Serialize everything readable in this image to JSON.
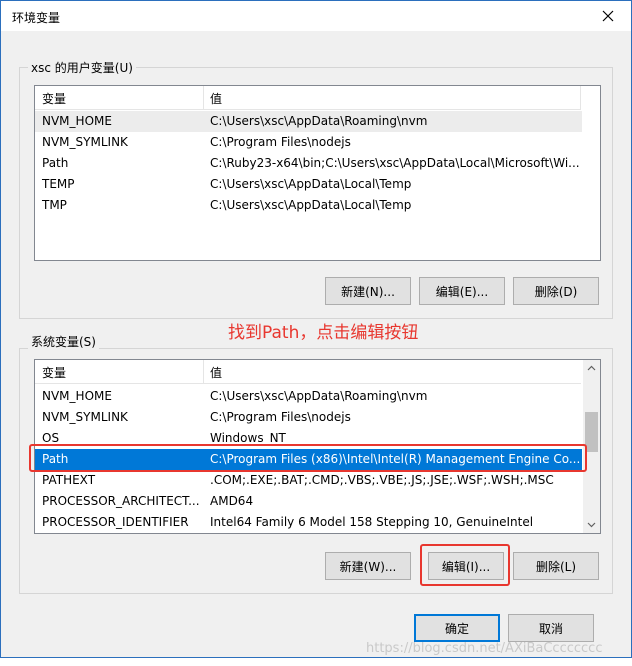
{
  "window": {
    "title": "环境变量"
  },
  "user_vars": {
    "group_label": "xsc 的用户变量(U)",
    "columns": [
      "变量",
      "值"
    ],
    "rows": [
      {
        "name": "NVM_HOME",
        "value": "C:\\Users\\xsc\\AppData\\Roaming\\nvm"
      },
      {
        "name": "NVM_SYMLINK",
        "value": "C:\\Program Files\\nodejs"
      },
      {
        "name": "Path",
        "value": "C:\\Ruby23-x64\\bin;C:\\Users\\xsc\\AppData\\Local\\Microsoft\\Wi..."
      },
      {
        "name": "TEMP",
        "value": "C:\\Users\\xsc\\AppData\\Local\\Temp"
      },
      {
        "name": "TMP",
        "value": "C:\\Users\\xsc\\AppData\\Local\\Temp"
      }
    ],
    "buttons": {
      "new": "新建(N)...",
      "edit": "编辑(E)...",
      "delete": "删除(D)"
    }
  },
  "annotation": "找到Path，点击编辑按钮",
  "system_vars": {
    "group_label": "系统变量(S)",
    "columns": [
      "变量",
      "值"
    ],
    "rows": [
      {
        "name": "NVM_HOME",
        "value": "C:\\Users\\xsc\\AppData\\Roaming\\nvm"
      },
      {
        "name": "NVM_SYMLINK",
        "value": "C:\\Program Files\\nodejs"
      },
      {
        "name": "OS",
        "value": "Windows_NT"
      },
      {
        "name": "Path",
        "value": "C:\\Program Files (x86)\\Intel\\Intel(R) Management Engine Co..."
      },
      {
        "name": "PATHEXT",
        "value": ".COM;.EXE;.BAT;.CMD;.VBS;.VBE;.JS;.JSE;.WSF;.WSH;.MSC"
      },
      {
        "name": "PROCESSOR_ARCHITECT...",
        "value": "AMD64"
      },
      {
        "name": "PROCESSOR_IDENTIFIER",
        "value": "Intel64 Family 6 Model 158 Stepping 10, GenuineIntel"
      }
    ],
    "selected_row": "Path",
    "buttons": {
      "new": "新建(W)...",
      "edit": "编辑(I)...",
      "delete": "删除(L)"
    }
  },
  "dialog_buttons": {
    "ok": "确定",
    "cancel": "取消"
  },
  "watermark": "https://blog.csdn.net/AXiBaCccccccc",
  "colors": {
    "selection": "#0078d7",
    "highlight_box": "#e8372f",
    "annotation_text": "#e8372f"
  }
}
